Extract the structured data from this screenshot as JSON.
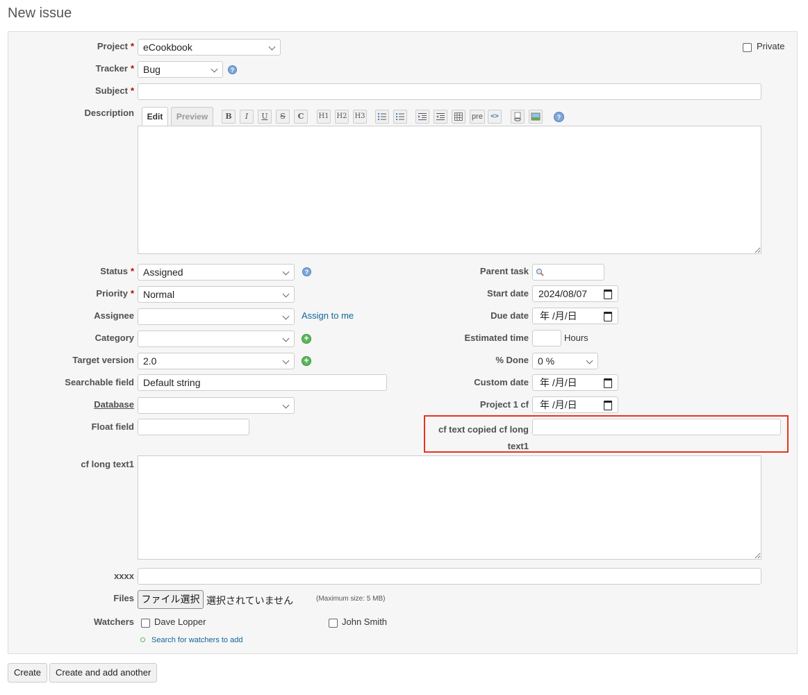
{
  "page": {
    "title": "New issue"
  },
  "form": {
    "project": {
      "label": "Project",
      "value": "eCookbook"
    },
    "tracker": {
      "label": "Tracker",
      "value": "Bug"
    },
    "subject": {
      "label": "Subject",
      "value": ""
    },
    "private_label": "Private",
    "description": {
      "label": "Description",
      "tab_edit": "Edit",
      "tab_preview": "Preview",
      "toolbar": {
        "bold": "B",
        "italic": "I",
        "underline": "U",
        "strike": "S",
        "code": "C",
        "h1": "H1",
        "h2": "H2",
        "h3": "H3",
        "pre": "pre",
        "help": "?"
      }
    },
    "status": {
      "label": "Status",
      "value": "Assigned"
    },
    "priority": {
      "label": "Priority",
      "value": "Normal"
    },
    "assignee": {
      "label": "Assignee",
      "value": "",
      "assign_to_me": "Assign to me"
    },
    "category": {
      "label": "Category",
      "value": ""
    },
    "target_version": {
      "label": "Target version",
      "value": "2.0"
    },
    "searchable_field": {
      "label": "Searchable field",
      "value": "Default string"
    },
    "database": {
      "label": "Database",
      "value": ""
    },
    "float_field": {
      "label": "Float field",
      "value": ""
    },
    "parent_task": {
      "label": "Parent task"
    },
    "start_date": {
      "label": "Start date",
      "value": "2024/08/07"
    },
    "due_date": {
      "label": "Due date",
      "value": "年 /月/日"
    },
    "estimated_time": {
      "label": "Estimated time",
      "unit": "Hours"
    },
    "done": {
      "label": "% Done",
      "value": "0 %"
    },
    "custom_date": {
      "label": "Custom date",
      "value": "年 /月/日"
    },
    "project1_cf": {
      "label": "Project 1 cf",
      "value": "年 /月/日"
    },
    "cf_text_copied": {
      "label_line1": "cf text copied cf long",
      "label_line2": "text1"
    },
    "cf_long_text1": {
      "label": "cf long text1"
    },
    "xxxx": {
      "label": "xxxx"
    },
    "files": {
      "label": "Files",
      "button": "ファイル選択",
      "status": "選択されていません",
      "max_size": "(Maximum size: 5 MB)"
    },
    "watchers": {
      "label": "Watchers",
      "list": [
        "Dave Lopper",
        "John Smith"
      ],
      "search_link": "Search for watchers to add"
    },
    "required_mark": "*"
  },
  "buttons": {
    "create": "Create",
    "create_add": "Create and add another"
  },
  "colors": {
    "highlight": "#e8321e",
    "link": "#116699",
    "required": "#bb0000"
  }
}
